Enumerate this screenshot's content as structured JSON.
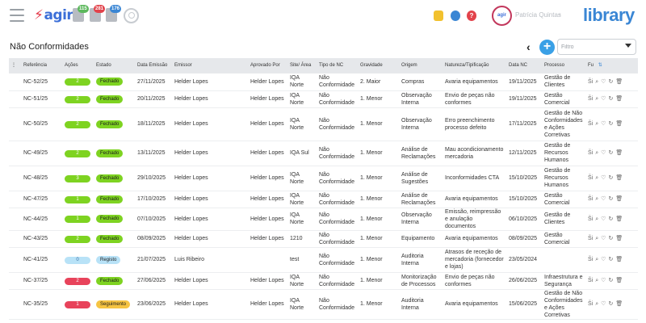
{
  "app": {
    "logo": "agir",
    "brand": "library",
    "user": "Patrícia Quintas",
    "avatar_text": "agir"
  },
  "badges": [
    {
      "count": "115",
      "color": "#5cb85c",
      "icon": "clipboard-icon"
    },
    {
      "count": "281",
      "color": "#e2434b",
      "icon": "clipboard-icon"
    },
    {
      "count": "176",
      "color": "#3a86d4",
      "icon": "clipboard-icon"
    }
  ],
  "header": {
    "title": "Não Conformidades",
    "filter_placeholder": "Filtro"
  },
  "columns": {
    "menu": "⋮",
    "ref": "Referência",
    "actions": "Ações",
    "state": "Estado",
    "emission_date": "Data Emissão",
    "emitter": "Emissor",
    "approved_by": "Aprovado Por",
    "site": "Site/ Área",
    "type": "Tipo de NC",
    "severity": "Gravidade",
    "origin": "Origem",
    "nature": "Natureza/Tipificação",
    "nc_date": "Data NC",
    "process": "Processo",
    "fu": "Fu"
  },
  "colors": {
    "green": "#7ed321",
    "lightblue": "#b8e2f7",
    "red": "#e8435b",
    "yellow": "#f6c443",
    "closed": "#7ed321",
    "registo": "#b8e2f7",
    "seguimento": "#f6c443"
  },
  "rows": [
    {
      "ref": "NC-52/25",
      "act": "2",
      "actc": "green",
      "state": "Fechado",
      "stc": "closed",
      "edate": "27/11/2025",
      "emitter": "Helder Lopes",
      "appr": "Helder Lopes",
      "site": "IQA Norte",
      "type": "Não Conformidade",
      "sev": "2. Maior",
      "origin": "Compras",
      "nature": "Avaria equipamentos",
      "ncdate": "19/11/2025",
      "process": "Gestão de Clientes"
    },
    {
      "ref": "NC-51/25",
      "act": "2",
      "actc": "green",
      "state": "Fechado",
      "stc": "closed",
      "edate": "20/11/2025",
      "emitter": "Helder Lopes",
      "appr": "Helder Lopes",
      "site": "IQA Norte",
      "type": "Não Conformidade",
      "sev": "1. Menor",
      "origin": "Observação Interna",
      "nature": "Envio de peças não conformes",
      "ncdate": "19/11/2025",
      "process": "Gestão Comercial"
    },
    {
      "ref": "NC-50/25",
      "act": "2",
      "actc": "green",
      "state": "Fechado",
      "stc": "closed",
      "edate": "18/11/2025",
      "emitter": "Helder Lopes",
      "appr": "Helder Lopes",
      "site": "IQA Norte",
      "type": "Não Conformidade",
      "sev": "1. Menor",
      "origin": "Observação Interna",
      "nature": "Erro preenchimento processo defeito",
      "ncdate": "17/11/2025",
      "process": "Gestão de Não Conformidades e Ações Corretivas"
    },
    {
      "ref": "NC-49/25",
      "act": "2",
      "actc": "green",
      "state": "Fechado",
      "stc": "closed",
      "edate": "13/11/2025",
      "emitter": "Helder Lopes",
      "appr": "Helder Lopes",
      "site": "IQA Sul",
      "type": "Não Conformidade",
      "sev": "1. Menor",
      "origin": "Análise de Reclamações",
      "nature": "Mau acondicionamento mercadoria",
      "ncdate": "12/11/2025",
      "process": "Gestão de Recursos Humanos"
    },
    {
      "ref": "NC-48/25",
      "act": "3",
      "actc": "green",
      "state": "Fechado",
      "stc": "closed",
      "edate": "29/10/2025",
      "emitter": "Helder Lopes",
      "appr": "Helder Lopes",
      "site": "IQA Norte",
      "type": "Não Conformidade",
      "sev": "1. Menor",
      "origin": "Análise de Sugestões",
      "nature": "Inconformidades CTA",
      "ncdate": "15/10/2025",
      "process": "Gestão de Recursos Humanos"
    },
    {
      "ref": "NC-47/25",
      "act": "1",
      "actc": "green",
      "state": "Fechado",
      "stc": "closed",
      "edate": "17/10/2025",
      "emitter": "Helder Lopes",
      "appr": "Helder Lopes",
      "site": "IQA Norte",
      "type": "Não Conformidade",
      "sev": "1. Menor",
      "origin": "Análise de Reclamações",
      "nature": "Avaria equipamentos",
      "ncdate": "15/10/2025",
      "process": "Gestão Comercial"
    },
    {
      "ref": "NC-44/25",
      "act": "1",
      "actc": "green",
      "state": "Fechado",
      "stc": "closed",
      "edate": "07/10/2025",
      "emitter": "Helder Lopes",
      "appr": "Helder Lopes",
      "site": "IQA Norte",
      "type": "Não Conformidade",
      "sev": "1. Menor",
      "origin": "Observação Interna",
      "nature": "Emissão, reimpressão e anulação documentos",
      "ncdate": "06/10/2025",
      "process": "Gestão de Clientes"
    },
    {
      "ref": "NC-43/25",
      "act": "2",
      "actc": "green",
      "state": "Fechado",
      "stc": "closed",
      "edate": "08/09/2025",
      "emitter": "Helder Lopes",
      "appr": "Helder Lopes",
      "site": "1210",
      "type": "Não Conformidade",
      "sev": "1. Menor",
      "origin": "Equipamento",
      "nature": "Avaria equipamentos",
      "ncdate": "08/09/2025",
      "process": "Gestão Comercial"
    },
    {
      "ref": "NC-41/25",
      "act": "0",
      "actc": "lightblue",
      "state": "Registo",
      "stc": "registo",
      "edate": "21/07/2025",
      "emitter": "Luis Ribeiro",
      "appr": "",
      "site": "test",
      "type": "Não Conformidade",
      "sev": "1. Menor",
      "origin": "Auditoria Interna",
      "nature": "Atrasos de receção de mercadoria (fornecedor e lojas)",
      "ncdate": "23/05/2024",
      "process": ""
    },
    {
      "ref": "NC-37/25",
      "act": "2",
      "actc": "red",
      "state": "Fechado",
      "stc": "closed",
      "edate": "27/06/2025",
      "emitter": "Helder Lopes",
      "appr": "Helder Lopes",
      "site": "IQA Norte",
      "type": "Não Conformidade",
      "sev": "1. Menor",
      "origin": "Monitorização de Processos",
      "nature": "Envio de peças não conformes",
      "ncdate": "26/06/2025",
      "process": "Infraestrutura e Segurança"
    },
    {
      "ref": "NC-35/25",
      "act": "1",
      "actc": "red",
      "state": "Seguimento",
      "stc": "seguimento",
      "edate": "23/06/2025",
      "emitter": "Helder Lopes",
      "appr": "Helder Lopes",
      "site": "IQA Norte",
      "type": "Não Conformidade",
      "sev": "1. Menor",
      "origin": "Auditoria Interna",
      "nature": "Avaria equipamentos",
      "ncdate": "15/06/2025",
      "process": "Gestão de Não Conformidades e Ações Corretivas"
    }
  ],
  "row_actions": {
    "first": "Ši",
    "icons": [
      "search-icon",
      "heart-icon",
      "refresh-icon",
      "trash-icon"
    ]
  }
}
